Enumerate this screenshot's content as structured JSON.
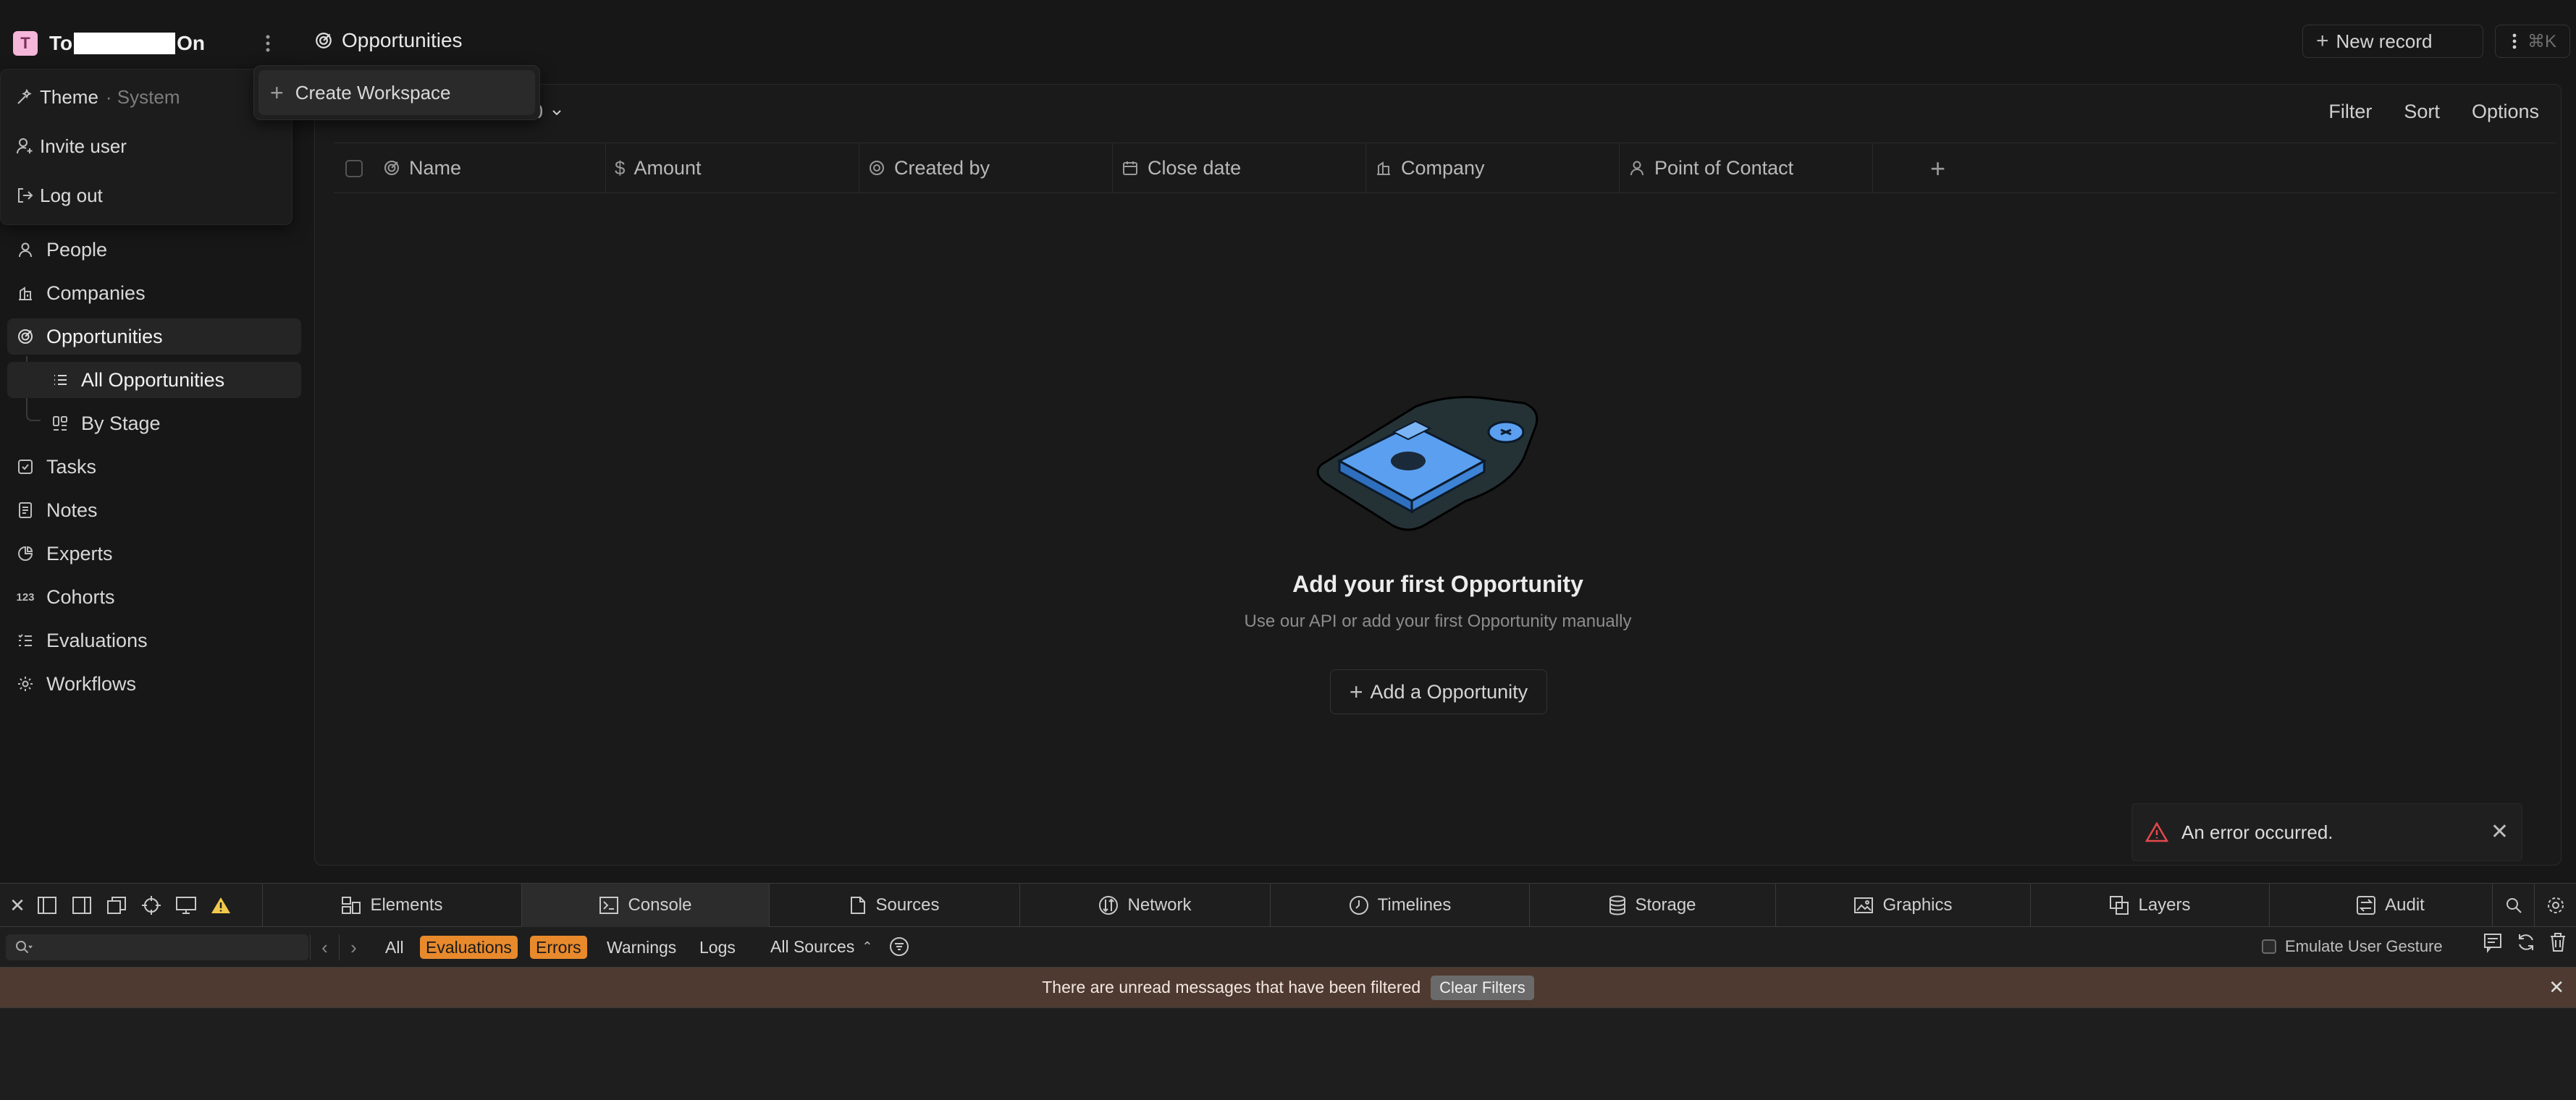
{
  "workspace": {
    "initial": "T",
    "name_prefix": "To",
    "name_suffix": "On"
  },
  "workspace_menu": {
    "theme_label": "Theme",
    "theme_value": "· System",
    "invite_label": "Invite user",
    "logout_label": "Log out"
  },
  "submenu": {
    "create_workspace": "Create Workspace"
  },
  "nav": {
    "people": "People",
    "companies": "Companies",
    "opportunities": "Opportunities",
    "all_opportunities": "All Opportunities",
    "by_stage": "By Stage",
    "tasks": "Tasks",
    "notes": "Notes",
    "experts": "Experts",
    "cohorts": "Cohorts",
    "evaluations": "Evaluations",
    "workflows": "Workflows"
  },
  "topbar": {
    "title": "Opportunities",
    "new_record": "New record",
    "shortcut": "⌘K"
  },
  "view": {
    "selector_partial": "0",
    "filter": "Filter",
    "sort": "Sort",
    "options": "Options"
  },
  "columns": {
    "name": "Name",
    "amount": "Amount",
    "created_by": "Created by",
    "close_date": "Close date",
    "company": "Company",
    "point_of_contact": "Point of Contact"
  },
  "empty": {
    "title": "Add your first Opportunity",
    "subtitle": "Use our API or add your first Opportunity manually",
    "button": "Add a Opportunity"
  },
  "toast": {
    "message": "An error occurred."
  },
  "devtools": {
    "tabs": {
      "elements": "Elements",
      "console": "Console",
      "sources": "Sources",
      "network": "Network",
      "timelines": "Timelines",
      "storage": "Storage",
      "graphics": "Graphics",
      "layers": "Layers",
      "audit": "Audit"
    },
    "filters": {
      "all": "All",
      "evaluations": "Evaluations",
      "errors": "Errors",
      "warnings": "Warnings",
      "logs": "Logs",
      "sources": "All Sources"
    },
    "emulate": "Emulate User Gesture",
    "banner": "There are unread messages that have been filtered",
    "clear_filters": "Clear Filters"
  },
  "colors": {
    "accent_orange": "#e88a2c",
    "avatar_pink": "#f4b6d9",
    "error_red": "#e5484d",
    "illus_blue": "#4a8fe0"
  }
}
